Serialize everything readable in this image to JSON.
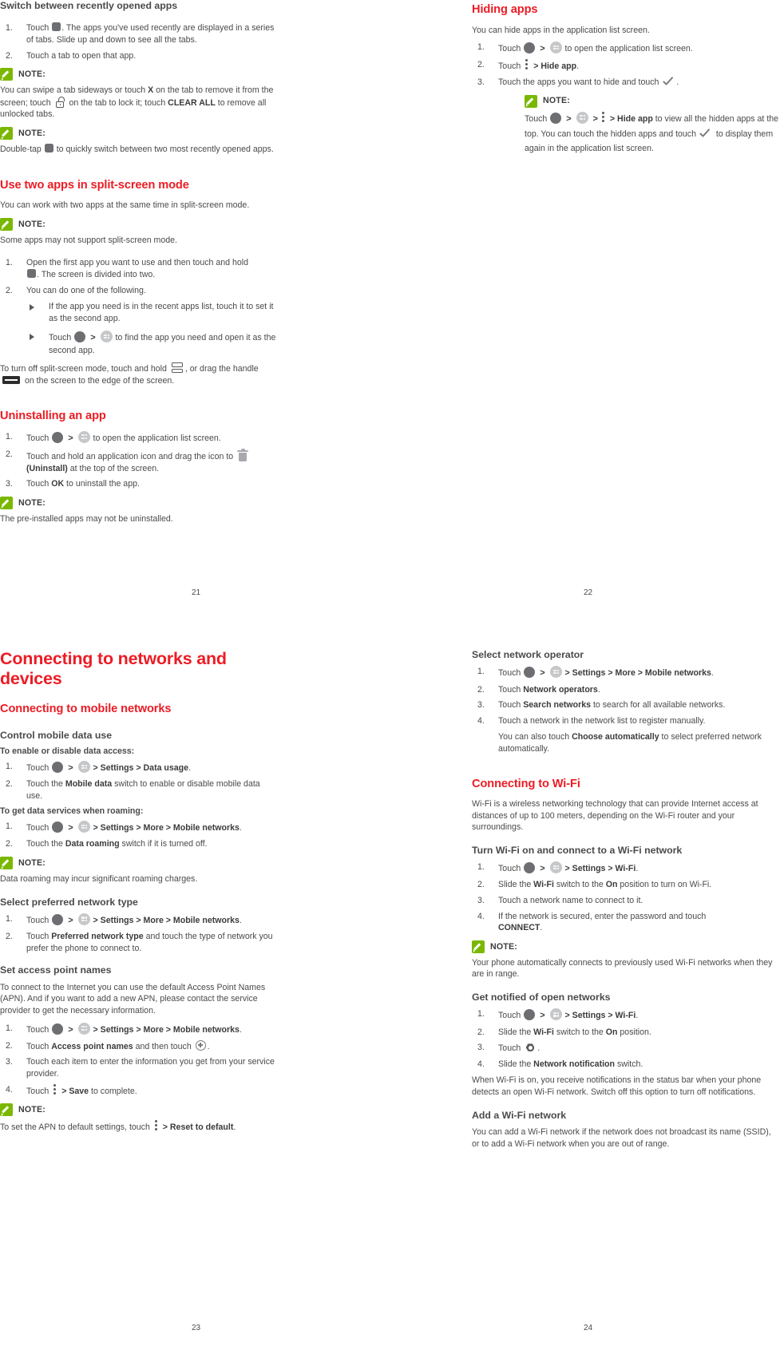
{
  "colors": {
    "heading_red": "#ec1c24",
    "note_green": "#7ab800",
    "body_gray": "#4a4a4a"
  },
  "page21": {
    "folio": "21",
    "h_switch": "Switch between recently opened apps",
    "s1_1a": "Touch",
    "s1_1b": ". The apps you've used recently are displayed in a series of tabs. Slide up and down to see all the tabs.",
    "s1_2": "Touch a tab to open that app.",
    "note_label": "NOTE:",
    "note1a": "You can swipe a tab sideways or touch ",
    "note1_x": "X",
    "note1b": " on the tab to remove it from the screen; touch ",
    "note1c": " on the tab to lock it; touch ",
    "note1_clear": "CLEAR ALL",
    "note1d": " to remove all unlocked tabs.",
    "note2a": "Double-tap",
    "note2b": " to quickly switch between two most recently opened apps.",
    "h_split": "Use two apps in split-screen mode",
    "split_intro": "You can work with two apps at the same time in split-screen mode.",
    "split_note": "Some apps may not support split-screen mode.",
    "split_1a": "Open the first app you want to use and then touch and hold",
    "split_1b": ". The screen is divided into two.",
    "split_2": "You can do one of the following.",
    "split_b1": "If the app you need is in the recent apps list, touch it to set it as the second app.",
    "split_b2a": "Touch",
    "split_b2b": "to find the app you need and open it as the second app.",
    "split_offa": "To turn off split-screen mode, touch and hold",
    "split_offb": ", or drag the handle",
    "split_offc": "on the screen to the edge of the screen.",
    "h_uninstall": "Uninstalling an app",
    "u1a": "Touch",
    "u1b": "to open the application list screen.",
    "u2a": "Touch and hold an application icon and drag the icon to",
    "u2_uninstall": "(Uninstall)",
    "u2b": " at the top of the screen.",
    "u3a": "Touch ",
    "u3_ok": "OK",
    "u3b": " to uninstall the app.",
    "u_note": "The pre-installed apps may not be uninstalled."
  },
  "page22": {
    "folio": "22",
    "h_hiding": "Hiding apps",
    "intro": "You can hide apps in the application list screen.",
    "h1a": "Touch",
    "h1b": "to open the application list screen.",
    "h2a": "Touch",
    "h2_hide": "> Hide app",
    "h2b": ".",
    "h3a": "Touch the apps you want to hide and touch",
    "h3b": ".",
    "note_label": "NOTE:",
    "n_toucha": "Touch",
    "n_hideapp": "> Hide app",
    "n_touchb": " to view all the hidden apps at the top. You can touch the hidden apps and touch",
    "n_touchc": " to display them again in the application list screen."
  },
  "page23": {
    "folio": "23",
    "h_connecting": "Connecting to networks and devices",
    "h_mobile": "Connecting to mobile networks",
    "h_control": "Control mobile data use",
    "sub_enable": "To enable or disable data access:",
    "c1a": "Touch",
    "c1_path": "> Settings > Data usage",
    "c1b": ".",
    "c2a": "Touch the ",
    "c2_bold": "Mobile data",
    "c2b": " switch to enable or disable mobile data use.",
    "sub_roaming": "To get data services when roaming:",
    "r1a": "Touch",
    "r1_path": "> Settings > More > Mobile networks",
    "r1b": ".",
    "r2a": "Touch the ",
    "r2_bold": "Data roaming",
    "r2b": " switch if it is turned off.",
    "note_label": "NOTE:",
    "r_note": "Data roaming may incur significant roaming charges.",
    "h_preferred": "Select preferred network type",
    "p1a": "Touch",
    "p1_path": "> Settings > More > Mobile networks",
    "p1b": ".",
    "p2a": "Touch ",
    "p2_bold": "Preferred network type",
    "p2b": " and touch the type of network you prefer the phone to connect to.",
    "h_apn": "Set access point names",
    "apn_intro": "To connect to the Internet you can use the default Access Point Names (APN). And if you want to add a new APN, please contact the service provider to get the necessary information.",
    "a1a": "Touch",
    "a1_path": "> Settings > More > Mobile networks",
    "a1b": ".",
    "a2a": "Touch ",
    "a2_bold": "Access point names",
    "a2b": " and then touch",
    "a2c": ".",
    "a3": "Touch each item to enter the information you get from your service provider.",
    "a4a": "Touch",
    "a4_bold": "> Save",
    "a4b": " to complete.",
    "apn_note_a": "To set the APN to default settings, touch",
    "apn_note_bold": "> Reset to default",
    "apn_note_b": "."
  },
  "page24": {
    "folio": "24",
    "h_operator": "Select network operator",
    "o1a": "Touch",
    "o1_path": "> Settings > More > Mobile networks",
    "o1b": ".",
    "o2a": "Touch ",
    "o2_bold": "Network operators",
    "o2b": ".",
    "o3a": "Touch ",
    "o3_bold": "Search networks",
    "o3b": " to search for all available networks.",
    "o4": "Touch a network in the network list to register manually.",
    "o_suba": "You can also touch ",
    "o_sub_bold": "Choose automatically",
    "o_subb": " to select preferred network automatically.",
    "h_wifi": "Connecting to Wi-Fi",
    "wifi_intro": "Wi-Fi is a wireless networking technology that can provide Internet access at distances of up to 100 meters, depending on the Wi-Fi router and your surroundings.",
    "h_turnon": "Turn Wi-Fi on and connect to a Wi-Fi network",
    "t1a": "Touch",
    "t1_path": "> Settings > Wi-Fi",
    "t1b": ".",
    "t2a": "Slide the ",
    "t2_b1": "Wi-Fi",
    "t2b": " switch to the ",
    "t2_b2": "On",
    "t2c": " position to turn on Wi-Fi.",
    "t3": "Touch a network name to connect to it.",
    "t4a": "If the network is secured, enter the password and touch ",
    "t4_bold": "CONNECT",
    "t4b": ".",
    "note_label": "NOTE:",
    "t_note": "Your phone automatically connects to previously used Wi-Fi networks when they are in range.",
    "h_notified": "Get notified of open networks",
    "g1a": "Touch",
    "g1_path": "> Settings > Wi-Fi",
    "g1b": ".",
    "g2a": "Slide the ",
    "g2_b1": "Wi-Fi",
    "g2b": " switch to the ",
    "g2_b2": "On",
    "g2c": " position.",
    "g3a": "Touch",
    "g3b": ".",
    "g4a": "Slide the ",
    "g4_bold": "Network notification",
    "g4b": " switch.",
    "g_para": "When Wi-Fi is on, you receive notifications in the status bar when your phone detects an open Wi-Fi network. Switch off this option to turn off notifications.",
    "h_add": "Add a Wi-Fi network",
    "add_para": "You can add a Wi-Fi network if the network does not broadcast its name (SSID), or to add a Wi-Fi network when you are out of range."
  }
}
